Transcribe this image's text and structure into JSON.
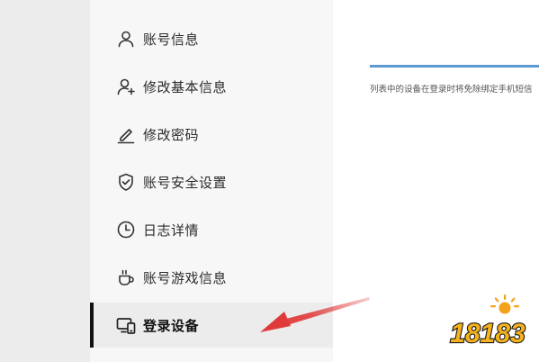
{
  "sidebar": {
    "items": [
      {
        "label": "账号信息",
        "icon": "user-icon"
      },
      {
        "label": "修改基本信息",
        "icon": "user-add-icon"
      },
      {
        "label": "修改密码",
        "icon": "pen-icon"
      },
      {
        "label": "账号安全设置",
        "icon": "shield-check-icon"
      },
      {
        "label": "日志详情",
        "icon": "clock-icon"
      },
      {
        "label": "账号游戏信息",
        "icon": "cup-icon"
      },
      {
        "label": "登录设备",
        "icon": "devices-icon",
        "active": true
      }
    ]
  },
  "main": {
    "description": "列表中的设备在登录时将免除绑定手机短信"
  },
  "annotation": {
    "arrow_color": "#e03a3a",
    "accent_color": "#5b9bd1"
  },
  "watermark": {
    "text": "18183",
    "icon": "sun-logo-icon"
  }
}
